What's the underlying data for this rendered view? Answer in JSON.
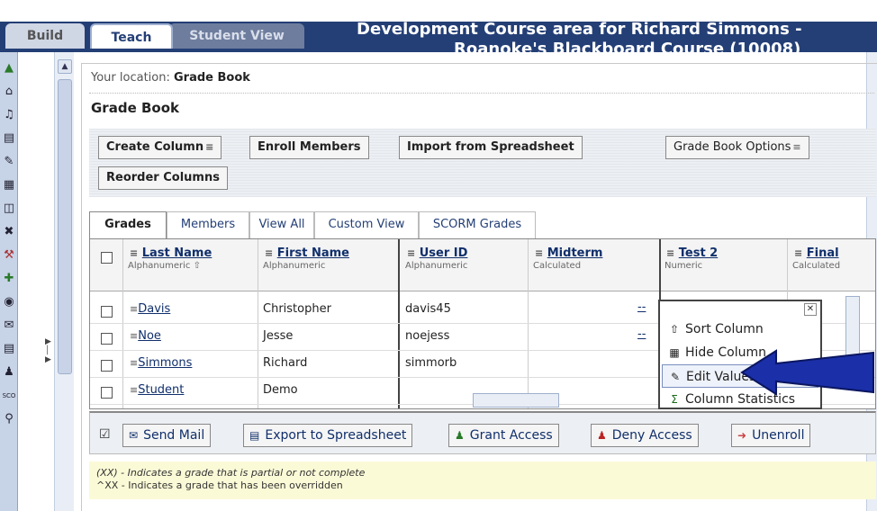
{
  "tabs": {
    "build": "Build",
    "teach": "Teach",
    "student_view": "Student View"
  },
  "course_title": {
    "line1": "Development Course area for Richard Simmons -",
    "line2": "Roanoke's Blackboard Course (10008)"
  },
  "left_icons": [
    "up-circle-icon",
    "home-icon",
    "announcement-icon",
    "syllabus-icon",
    "pencil-icon",
    "calendar-icon",
    "discussion-icon",
    "pin-icon",
    "tools-icon",
    "new-item-icon",
    "compass-icon",
    "mail-icon",
    "document-icon",
    "people-icon",
    "scorm-icon",
    "search-icon"
  ],
  "breadcrumb": {
    "prefix": "Your location: ",
    "current": "Grade Book"
  },
  "page_title": "Grade Book",
  "toolbar": {
    "create_column": "Create Column",
    "enroll_members": "Enroll Members",
    "import_spreadsheet": "Import from Spreadsheet",
    "grade_book_options": "Grade Book Options",
    "reorder_columns": "Reorder Columns"
  },
  "subtabs": [
    "Grades",
    "Members",
    "View All",
    "Custom View",
    "SCORM Grades"
  ],
  "columns": [
    {
      "title": "Last Name",
      "sub": "Alphanumeric ⇧"
    },
    {
      "title": "First Name",
      "sub": "Alphanumeric"
    },
    {
      "title": "User ID",
      "sub": "Alphanumeric"
    },
    {
      "title": "Midterm",
      "sub": "Calculated"
    },
    {
      "title": "Test 2",
      "sub": "Numeric"
    },
    {
      "title": "Final",
      "sub": "Calculated"
    }
  ],
  "rows": [
    {
      "last": "Davis",
      "first": "Christopher",
      "user": "davis45",
      "midterm": "--",
      "midterm_shown": true
    },
    {
      "last": "Noe",
      "first": "Jesse",
      "user": "noejess",
      "midterm": "--",
      "midterm_shown": true
    },
    {
      "last": "Simmons",
      "first": "Richard",
      "user": "simmorb",
      "midterm": "",
      "midterm_shown": false
    },
    {
      "last": "Student",
      "first": "Demo",
      "user": "",
      "midterm": "",
      "midterm_shown": false
    }
  ],
  "context_menu": {
    "items": [
      "Sort Column",
      "Hide Column",
      "Edit Values",
      "Column Statistics"
    ],
    "highlighted": "Edit Values"
  },
  "actions": [
    "Send Mail",
    "Export to Spreadsheet",
    "Grant Access",
    "Deny Access",
    "Unenroll"
  ],
  "legend": {
    "line1": "(XX) - Indicates a grade that is partial or not complete",
    "line2": "^XX - Indicates a grade that has been overridden"
  },
  "colors": {
    "header_bg": "#243f76",
    "link": "#102f6b",
    "arrow": "#1a2fa8",
    "legend_bg": "#fbfad7"
  }
}
